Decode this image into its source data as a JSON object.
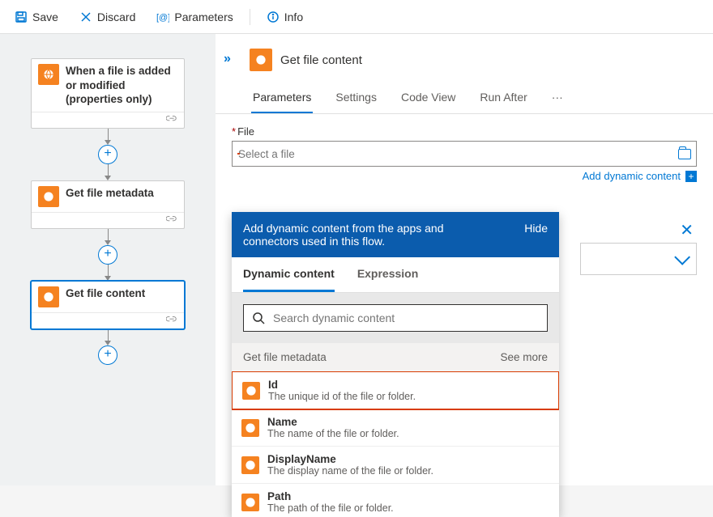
{
  "toolbar": {
    "save": "Save",
    "discard": "Discard",
    "parameters": "Parameters",
    "info": "Info"
  },
  "flow": {
    "steps": [
      {
        "title": "When a file is added or modified (properties only)"
      },
      {
        "title": "Get file metadata"
      },
      {
        "title": "Get file content"
      }
    ]
  },
  "panel": {
    "title": "Get file content",
    "tabs": [
      "Parameters",
      "Settings",
      "Code View",
      "Run After"
    ],
    "file_label": "File",
    "file_placeholder": "Select a file",
    "add_dynamic": "Add dynamic content"
  },
  "dc": {
    "banner": "Add dynamic content from the apps and connectors used in this flow.",
    "hide": "Hide",
    "tabs": [
      "Dynamic content",
      "Expression"
    ],
    "search_placeholder": "Search dynamic content",
    "group": "Get file metadata",
    "see_more": "See more",
    "items": [
      {
        "title": "Id",
        "desc": "The unique id of the file or folder."
      },
      {
        "title": "Name",
        "desc": "The name of the file or folder."
      },
      {
        "title": "DisplayName",
        "desc": "The display name of the file or folder."
      },
      {
        "title": "Path",
        "desc": "The path of the file or folder."
      }
    ]
  }
}
